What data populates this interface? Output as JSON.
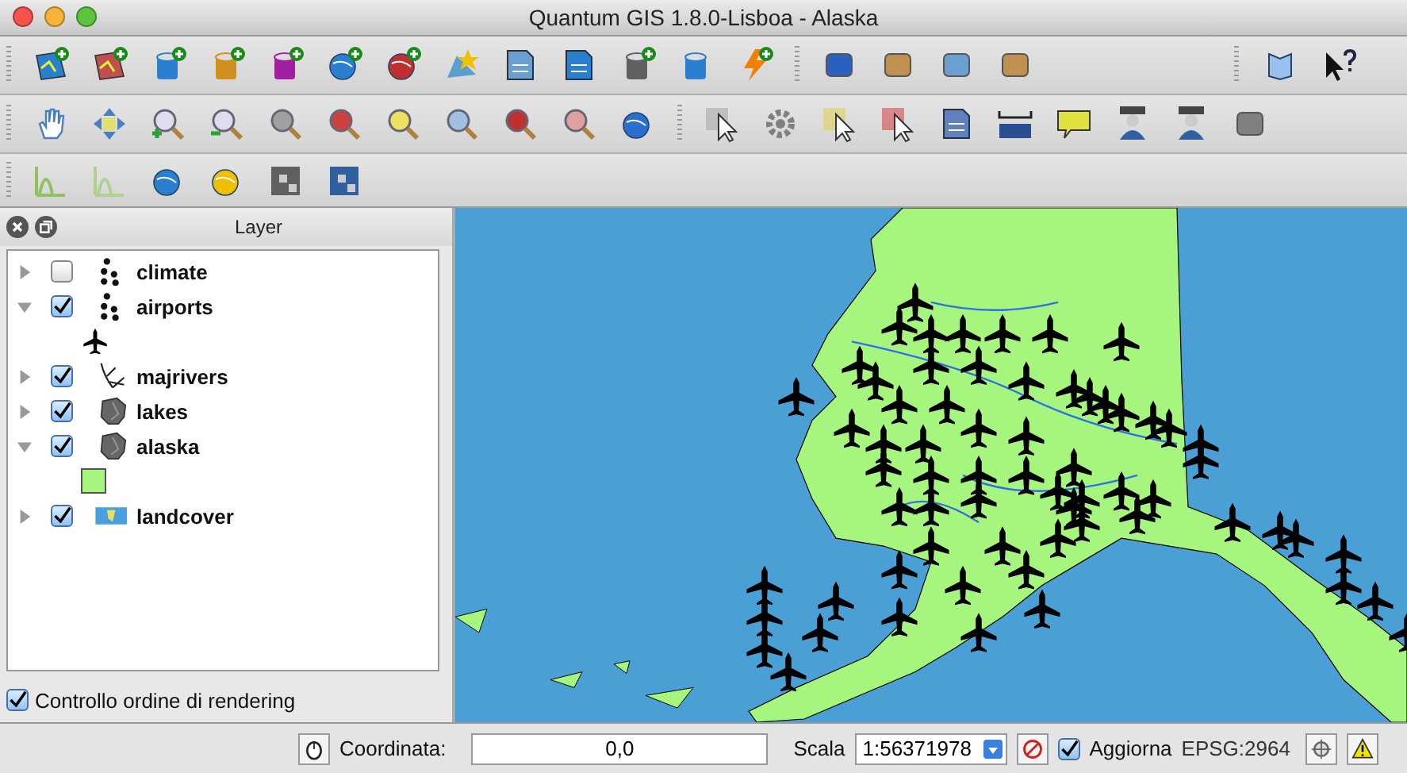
{
  "window": {
    "title": "Quantum GIS 1.8.0-Lisboa - Alaska"
  },
  "layers_panel": {
    "title": "Layer",
    "layers": [
      {
        "name": "climate",
        "checked": false,
        "expanded": false,
        "kind": "points"
      },
      {
        "name": "airports",
        "checked": true,
        "expanded": true,
        "kind": "points",
        "children": [
          {
            "kind": "plane"
          }
        ]
      },
      {
        "name": "majrivers",
        "checked": true,
        "expanded": false,
        "kind": "lines"
      },
      {
        "name": "lakes",
        "checked": true,
        "expanded": false,
        "kind": "polygon"
      },
      {
        "name": "alaska",
        "checked": true,
        "expanded": true,
        "kind": "polygon",
        "children": [
          {
            "kind": "fill",
            "color": "#a5f57f"
          }
        ]
      },
      {
        "name": "landcover",
        "checked": true,
        "expanded": false,
        "kind": "raster"
      }
    ]
  },
  "render_order": {
    "label": "Controllo ordine di rendering",
    "checked": true
  },
  "status_bar": {
    "coordinate_label": "Coordinata:",
    "coordinate_value": "0,0",
    "scale_label": "Scala",
    "scale_value": "1:56371978",
    "update": {
      "label": "Aggiorna",
      "checked": true
    },
    "crs": "EPSG:2964"
  }
}
